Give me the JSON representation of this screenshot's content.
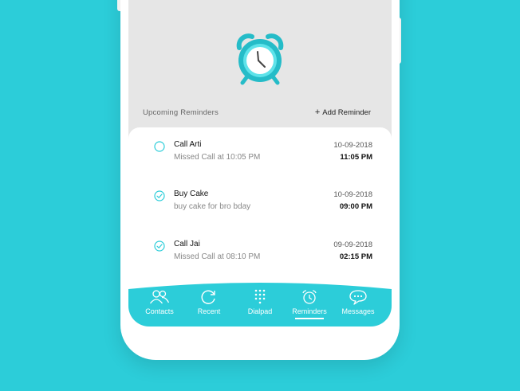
{
  "header": {
    "section_title": "Upcoming Reminders",
    "add_label": "Add Reminder",
    "add_icon": "plus-icon"
  },
  "colors": {
    "accent": "#2ccdd9",
    "alarm_dark": "#25bcc8",
    "alarm_light": "#5ee3ea",
    "screen_bg": "#e6e6e6"
  },
  "reminders": [
    {
      "title": "Call Arti",
      "subtitle": "Missed Call at 10:05 PM",
      "date": "10-09-2018",
      "time": "11:05 PM",
      "done": false
    },
    {
      "title": "Buy Cake",
      "subtitle": "buy cake for bro bday",
      "date": "10-09-2018",
      "time": "09:00 PM",
      "done": true
    },
    {
      "title": "Call Jai",
      "subtitle": "Missed Call at 08:10 PM",
      "date": "09-09-2018",
      "time": "02:15 PM",
      "done": true
    }
  ],
  "tabs": [
    {
      "label": "Contacts",
      "icon": "contacts-icon",
      "active": false
    },
    {
      "label": "Recent",
      "icon": "refresh-icon",
      "active": false
    },
    {
      "label": "Dialpad",
      "icon": "dialpad-icon",
      "active": false
    },
    {
      "label": "Reminders",
      "icon": "alarm-clock-icon",
      "active": true
    },
    {
      "label": "Messages",
      "icon": "chat-bubble-icon",
      "active": false
    }
  ]
}
